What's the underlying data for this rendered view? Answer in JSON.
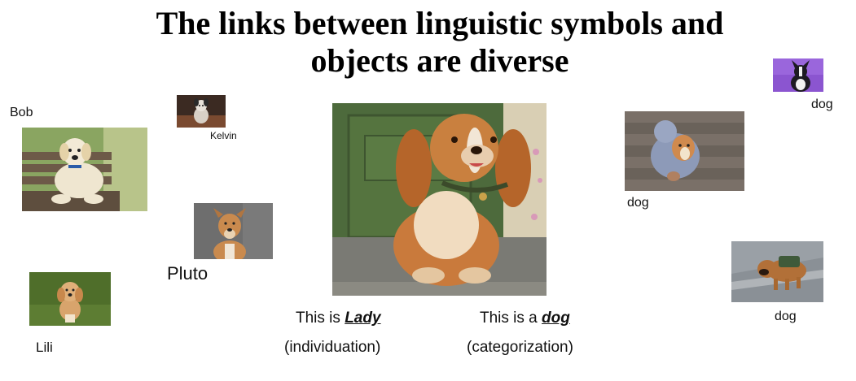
{
  "title": {
    "line1": "The links between linguistic symbols and",
    "line2": "objects are diverse"
  },
  "labels": {
    "bob": "Bob",
    "kelvin": "Kelvin",
    "pluto": "Pluto",
    "lili": "Lili",
    "dog_top_right": "dog",
    "dog_middle_right": "dog",
    "dog_bottom_right": "dog"
  },
  "captions": {
    "lady_prefix": "This is ",
    "lady_name": "Lady",
    "individuation": "(individuation)",
    "dog_prefix": "This is a ",
    "dog_word": "dog",
    "categorization": "(categorization)"
  }
}
